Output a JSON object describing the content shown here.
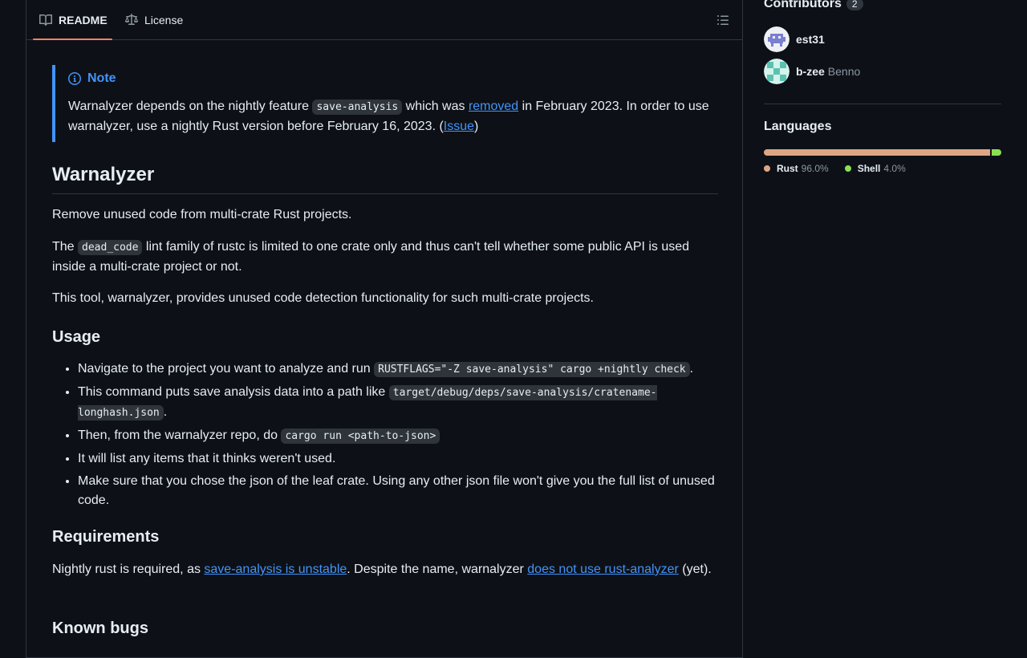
{
  "tabs": {
    "readme": "README",
    "license": "License"
  },
  "note": {
    "title": "Note",
    "t1": "Warnalyzer depends on the nightly feature ",
    "code": "save-analysis",
    "t2": " which was ",
    "link_removed": "removed",
    "t3": " in February 2023. In order to use warnalyzer, use a nightly Rust version before February 16, 2023. (",
    "link_issue": "Issue",
    "t4": ")"
  },
  "title": "Warnalyzer",
  "intro": "Remove unused code from multi-crate Rust projects.",
  "p2": {
    "t1": "The ",
    "code": "dead_code",
    "t2": " lint family of rustc is limited to one crate only and thus can't tell whether some public API is used inside a multi-crate project or not."
  },
  "p3": "This tool, warnalyzer, provides unused code detection functionality for such multi-crate projects.",
  "usage": {
    "heading": "Usage",
    "b1_text": "Navigate to the project you want to analyze and run ",
    "b1_code": "RUSTFLAGS=\"-Z save-analysis\" cargo +nightly check",
    "b1_end": ".",
    "b2_text": "This command puts save analysis data into a path like ",
    "b2_code": "target/debug/deps/save-analysis/cratename-longhash.json",
    "b2_end": ".",
    "b3_text": "Then, from the warnalyzer repo, do ",
    "b3_code": "cargo run <path-to-json>",
    "b4": "It will list any items that it thinks weren't used.",
    "b5": "Make sure that you chose the json of the leaf crate. Using any other json file won't give you the full list of unused code."
  },
  "requirements": {
    "heading": "Requirements",
    "t1": "Nightly rust is required, as ",
    "link1": "save-analysis is unstable",
    "t2": ". Despite the name, warnalyzer ",
    "link2": "does not use rust-analyzer",
    "t3": " (yet)."
  },
  "known_bugs": {
    "heading": "Known bugs"
  },
  "sidebar": {
    "contributors_heading": "Contributors",
    "contributors_count": "2",
    "contributors": [
      {
        "login": "est31",
        "name": ""
      },
      {
        "login": "b-zee",
        "name": "Benno"
      }
    ],
    "languages_heading": "Languages",
    "languages": [
      {
        "name": "Rust",
        "percent": "96.0%",
        "value": 96.0,
        "color": "#dea584"
      },
      {
        "name": "Shell",
        "percent": "4.0%",
        "value": 4.0,
        "color": "#89e051"
      }
    ]
  },
  "icons": {
    "readme_tab": "book-icon",
    "license_tab": "law-icon",
    "toc": "list-unordered-icon",
    "note": "info-icon"
  }
}
